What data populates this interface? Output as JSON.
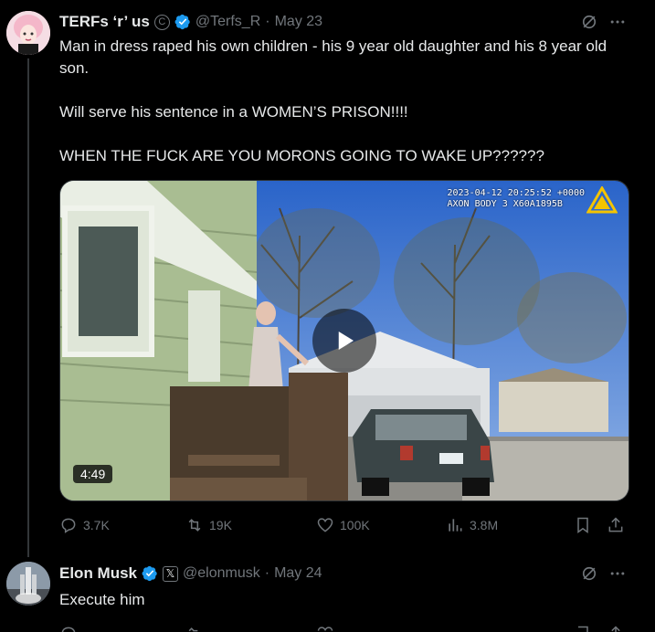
{
  "tweet1": {
    "display_name": "TERFs ‘r’ us",
    "handle": "@Terfs_R",
    "separator": "·",
    "date": "May 23",
    "text": "Man in dress raped his own children - his 9 year old daughter and his 8 year old son.\n\nWill serve his sentence in a WOMEN’S PRISON!!!!\n\nWHEN THE FUCK ARE YOU MORONS GOING TO WAKE UP??????",
    "video": {
      "timestamp_line1": "2023-04-12 20:25:52 +0000",
      "timestamp_line2": "AXON BODY 3 X60A1895B",
      "duration": "4:49"
    },
    "actions": {
      "replies": "3.7K",
      "reposts": "19K",
      "likes": "100K",
      "views": "3.8M"
    }
  },
  "tweet2": {
    "display_name": "Elon Musk",
    "handle": "@elonmusk",
    "separator": "·",
    "date": "May 24",
    "text": "Execute him",
    "badge_letter": "𝕏"
  },
  "icons": {
    "reply": "reply-icon",
    "repost": "repost-icon",
    "like": "heart-icon",
    "views": "views-icon",
    "bookmark": "bookmark-icon",
    "share": "share-icon",
    "grok": "grok-icon",
    "more": "more-icon",
    "play": "play-icon"
  },
  "colors": {
    "background": "#000000",
    "text": "#e7e9ea",
    "muted": "#71767b",
    "verified": "#1d9bf0"
  }
}
